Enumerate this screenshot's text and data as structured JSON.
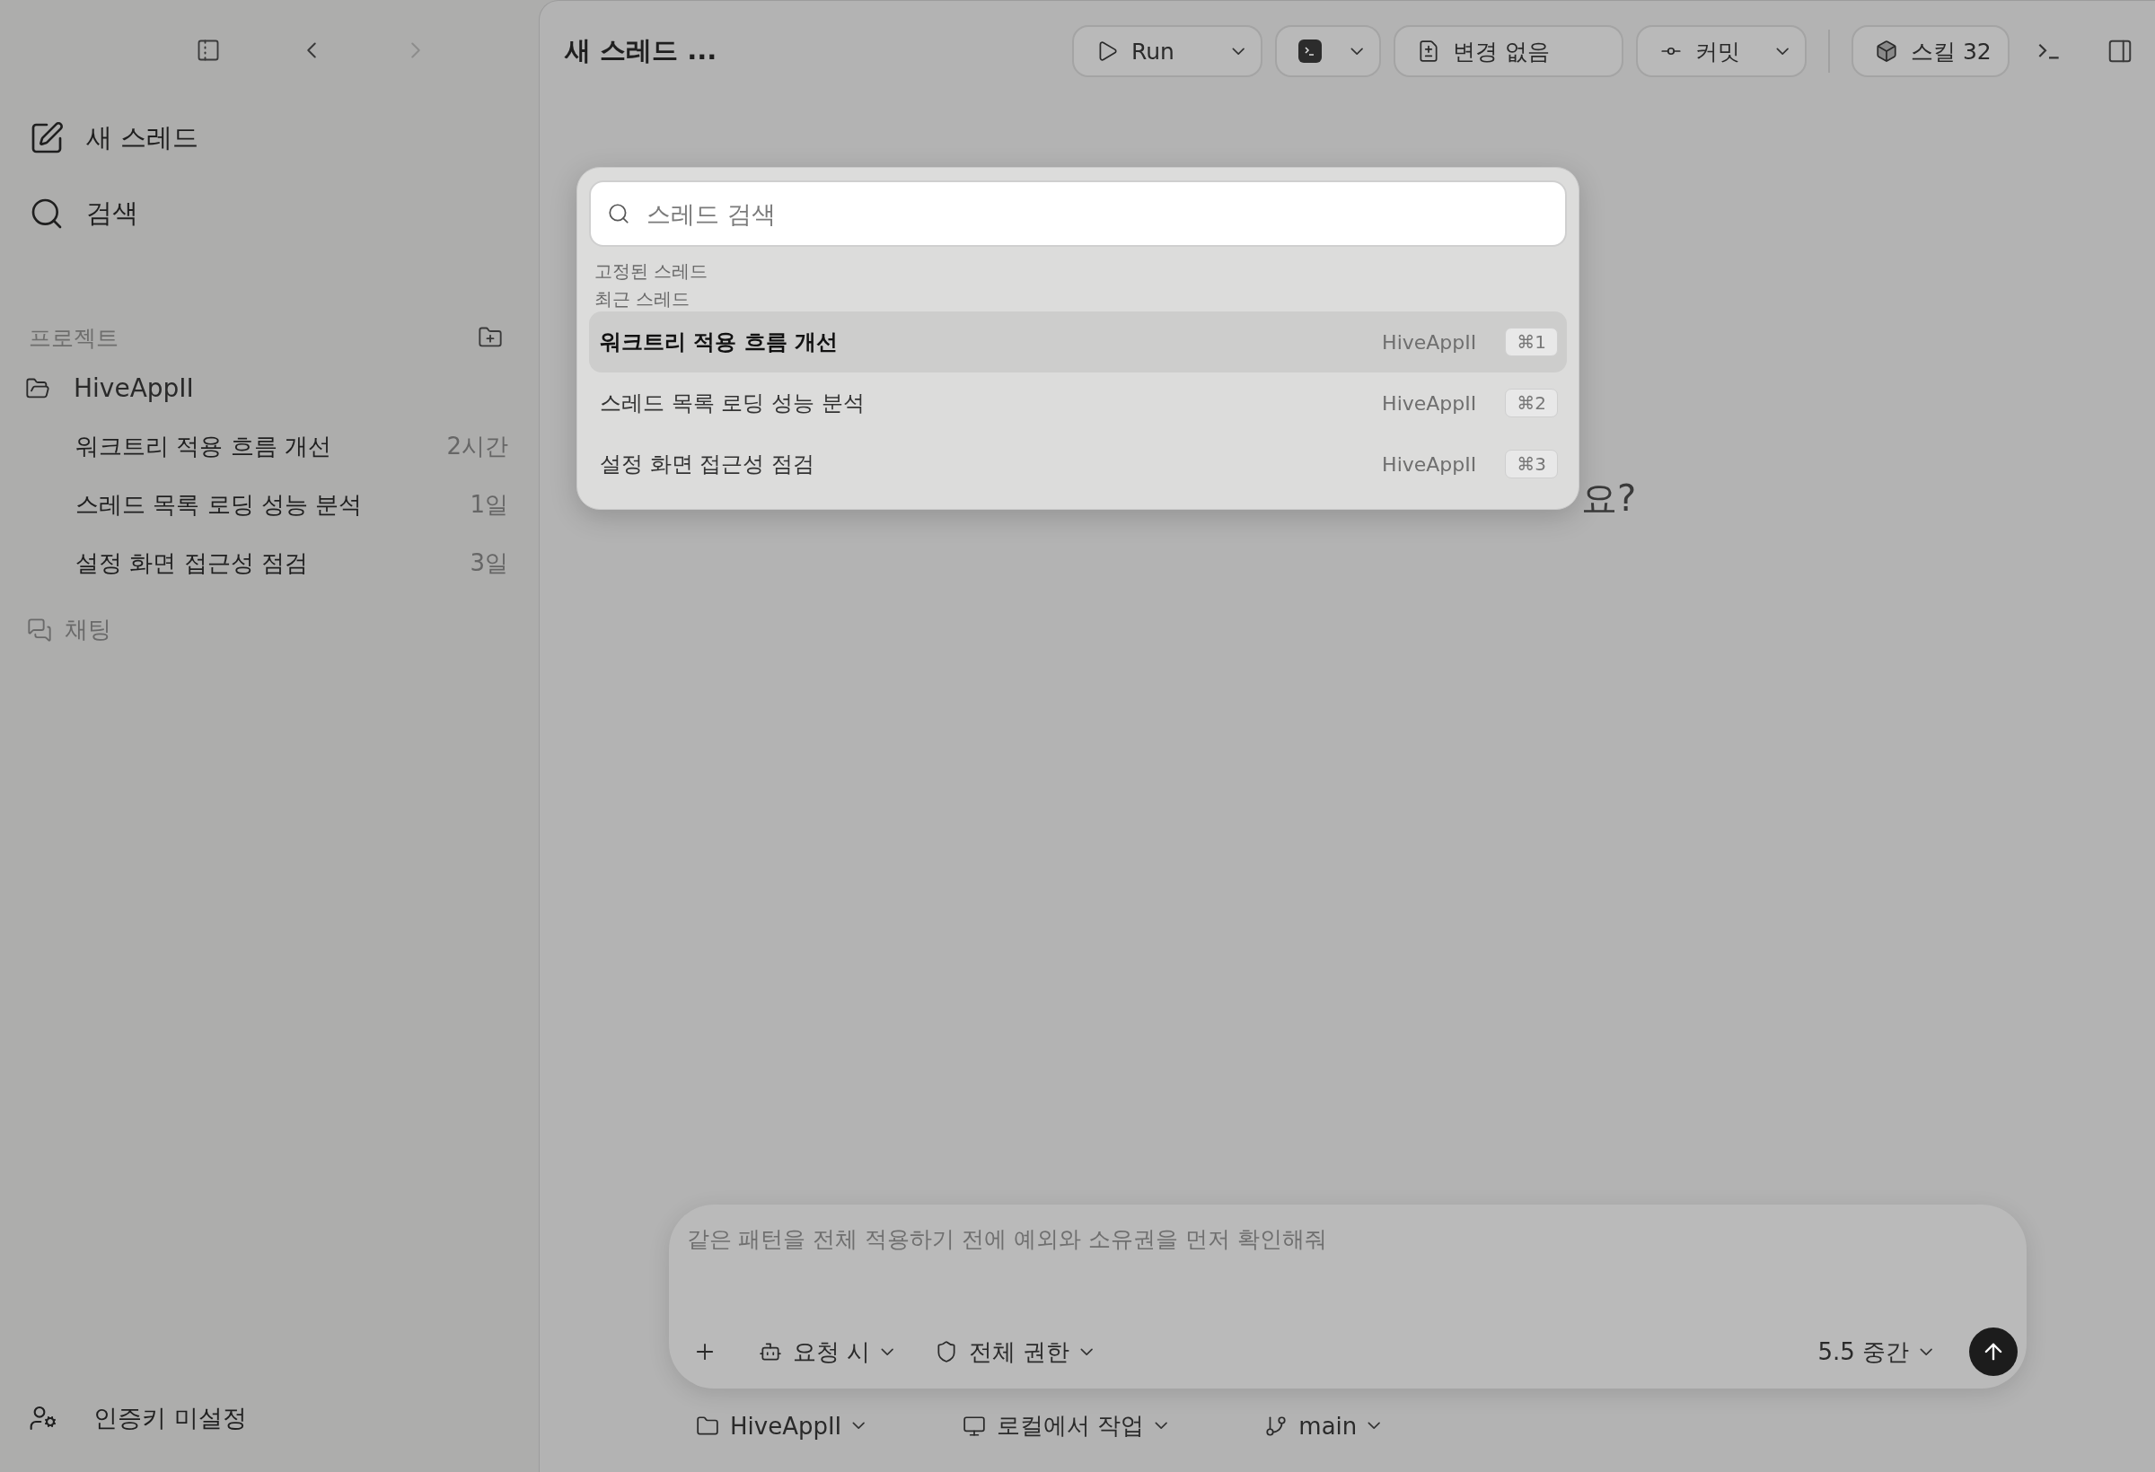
{
  "sidebar": {
    "new_thread": "새 스레드",
    "search": "검색",
    "projects_label": "프로젝트",
    "projects": [
      {
        "name": "HiveAppII",
        "expanded": true,
        "threads": [
          {
            "title": "워크트리 적용 흐름 개선",
            "age": "2시간"
          },
          {
            "title": "스레드 목록 로딩 성능 분석",
            "age": "1일"
          },
          {
            "title": "설정 화면 접근성 점검",
            "age": "3일"
          }
        ]
      }
    ],
    "chat": "채팅",
    "auth": "인증키 미설정"
  },
  "toolbar": {
    "title": "새 스레드 ...",
    "run": "Run",
    "changes": "변경 없음",
    "commit": "커밋",
    "skills": "스킬 32"
  },
  "heading_visible": "요?",
  "thread_search": {
    "placeholder": "스레드 검색",
    "pinned_label": "고정된 스레드",
    "recent_label": "최근 스레드",
    "results": [
      {
        "title": "워크트리 적용 흐름 개선",
        "project": "HiveAppII",
        "shortcut": "⌘1",
        "selected": true
      },
      {
        "title": "스레드 목록 로딩 성능 분석",
        "project": "HiveAppII",
        "shortcut": "⌘2",
        "selected": false
      },
      {
        "title": "설정 화면 접근성 점검",
        "project": "HiveAppII",
        "shortcut": "⌘3",
        "selected": false
      }
    ]
  },
  "composer": {
    "placeholder": "같은 패턴을 전체 적용하기 전에 예외와 소유권을 먼저 확인해줘",
    "mode": "요청 시",
    "permission": "전체 권한",
    "model": "5.5 중간"
  },
  "footer": {
    "project": "HiveAppII",
    "environment": "로컬에서 작업",
    "branch": "main"
  }
}
